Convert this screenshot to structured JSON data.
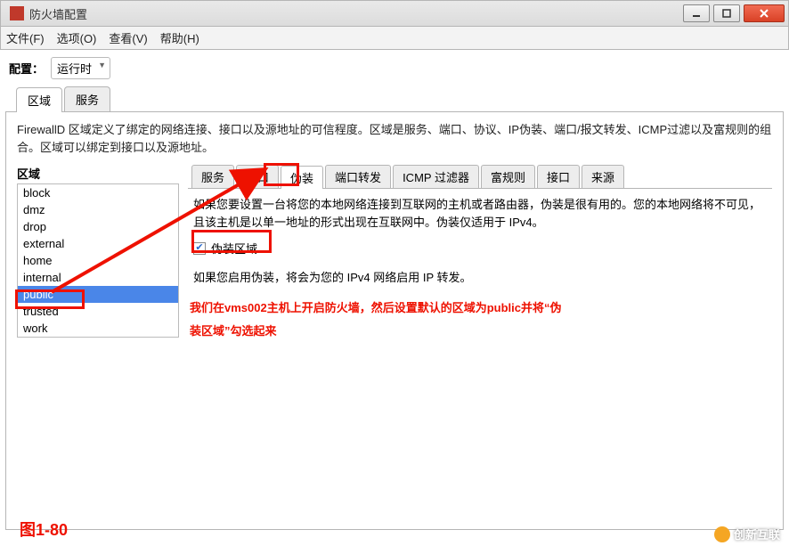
{
  "window": {
    "title": "防火墙配置"
  },
  "menu": {
    "file": "文件(F)",
    "options": "选项(O)",
    "view": "查看(V)",
    "help": "帮助(H)"
  },
  "config": {
    "label": "配置：",
    "value": "运行时"
  },
  "top_tabs": {
    "zone": "区域",
    "service": "服务"
  },
  "panel_desc": "FirewallD 区域定义了绑定的网络连接、接口以及源地址的可信程度。区域是服务、端口、协议、IP伪装、端口/报文转发、ICMP过滤以及富规则的组合。区域可以绑定到接口以及源地址。",
  "zone_header": "区域",
  "zones": [
    "block",
    "dmz",
    "drop",
    "external",
    "home",
    "internal",
    "public",
    "trusted",
    "work"
  ],
  "selected_zone": "public",
  "sub_tabs": {
    "service": "服务",
    "port": "端口",
    "masq": "伪装",
    "portfwd": "端口转发",
    "icmp": "ICMP 过滤器",
    "rich": "富规则",
    "iface": "接口",
    "source": "来源"
  },
  "masq": {
    "help1": "如果您要设置一台将您的本地网络连接到互联网的主机或者路由器，伪装是很有用的。您的本地网络将不可见，且该主机是以单一地址的形式出现在互联网中。伪装仅适用于 IPv4。",
    "chk_label": "伪装区域",
    "help2": "如果您启用伪装，将会为您的 IPv4 网络启用 IP 转发。"
  },
  "annotation": {
    "line1": "我们在vms002主机上开启防火墙，然后设置默认的区域为public并将“伪",
    "line2": "装区域”勾选起来",
    "figure": "图1-80"
  },
  "watermark": "创新互联"
}
